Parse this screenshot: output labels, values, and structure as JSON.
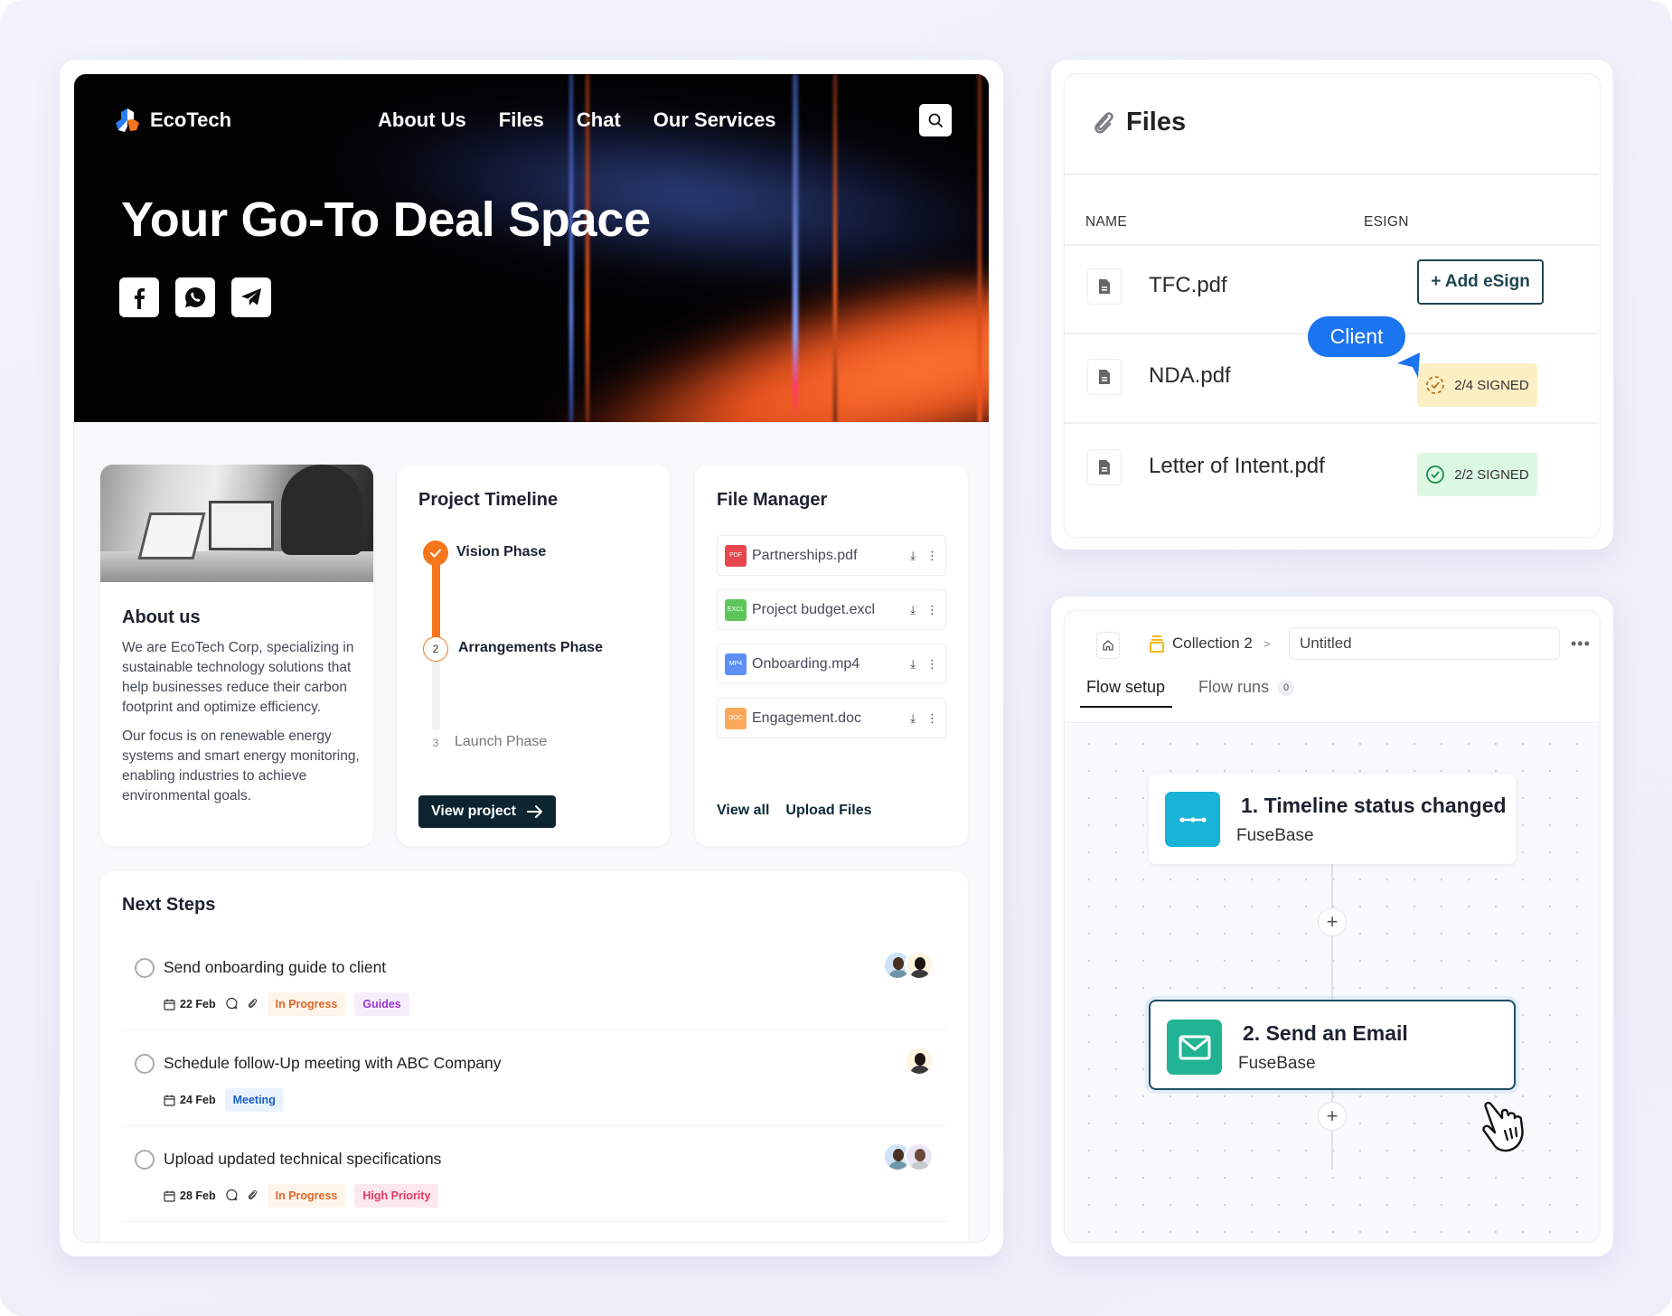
{
  "brand": {
    "name": "EcoTech",
    "logo_icon": "ecotech-logo-icon"
  },
  "nav": {
    "items": [
      "About Us",
      "Files",
      "Chat",
      "Our Services"
    ],
    "search_icon": "search-icon"
  },
  "hero": {
    "title": "Your Go-To Deal Space",
    "social": [
      "facebook-icon",
      "whatsapp-icon",
      "telegram-icon"
    ]
  },
  "about": {
    "title": "About us",
    "paragraphs": [
      "We are EcoTech Corp, specializing in sustainable technology solutions that help businesses reduce their carbon footprint and optimize efficiency.",
      "Our focus is on renewable energy systems and smart energy monitoring, enabling industries to achieve environmental goals."
    ]
  },
  "timeline": {
    "title": "Project Timeline",
    "progress_fraction": 0.5,
    "phases": [
      {
        "step": "✓",
        "label": "Vision Phase",
        "status": "done"
      },
      {
        "step": "2",
        "label": "Arrangements Phase",
        "status": "current"
      },
      {
        "step": "3",
        "label": "Launch Phase",
        "status": "upcoming"
      }
    ],
    "button": "View project"
  },
  "file_manager": {
    "title": "File Manager",
    "files": [
      {
        "type": "PDF",
        "name": "Partnerships.pdf",
        "color": "#e5474d"
      },
      {
        "type": "EXCL",
        "name": "Project budget.excl",
        "color": "#5cc65a"
      },
      {
        "type": "MP4",
        "name": "Onboarding.mp4",
        "color": "#5b8ff5"
      },
      {
        "type": "DOC",
        "name": "Engagement.doc",
        "color": "#f8a858"
      }
    ],
    "actions": {
      "download": "⤓",
      "more": "⋮"
    },
    "links": [
      "View all",
      "Upload Files"
    ]
  },
  "next_steps": {
    "title": "Next Steps",
    "items": [
      {
        "text": "Send onboarding guide to client",
        "date": "22 Feb",
        "has_comments": true,
        "has_attachments": true,
        "tags": [
          {
            "label": "In Progress",
            "fg": "#e0672a",
            "bg": "#fff4ea"
          },
          {
            "label": "Guides",
            "fg": "#9b36d6",
            "bg": "#f7eefd"
          }
        ],
        "avatars": 2
      },
      {
        "text": "Schedule follow-Up meeting with ABC Company",
        "date": "24 Feb",
        "has_comments": false,
        "has_attachments": false,
        "tags": [
          {
            "label": "Meeting",
            "fg": "#1b5fc9",
            "bg": "#eaf3fd"
          }
        ],
        "avatars": 1
      },
      {
        "text": "Upload updated technical specifications",
        "date": "28 Feb",
        "has_comments": true,
        "has_attachments": true,
        "tags": [
          {
            "label": "In Progress",
            "fg": "#e0672a",
            "bg": "#fff4ea"
          },
          {
            "label": "High Priority",
            "fg": "#e23a5f",
            "bg": "#fde8ee"
          }
        ],
        "avatars": 2
      }
    ]
  },
  "files_panel": {
    "title": "Files",
    "columns": {
      "name": "NAME",
      "esign": "ESIGN"
    },
    "rows": [
      {
        "name": "TFC.pdf",
        "esign": {
          "kind": "button",
          "label": "+ Add eSign"
        }
      },
      {
        "name": "NDA.pdf",
        "esign": {
          "kind": "status",
          "label": "2/4 SIGNED",
          "bg": "#fdefc4",
          "icon_color": "#b8761a"
        }
      },
      {
        "name": "Letter of Intent.pdf",
        "esign": {
          "kind": "status",
          "label": "2/2 SIGNED",
          "bg": "#dcf8e3",
          "icon_color": "#1f8a49"
        }
      }
    ],
    "cursor_label": "Client"
  },
  "flow": {
    "breadcrumb": {
      "collection": "Collection 2",
      "separator": ">",
      "title_value": "Untitled"
    },
    "more_label": "•••",
    "tabs": [
      {
        "label": "Flow setup",
        "active": true
      },
      {
        "label": "Flow runs",
        "count": "0",
        "active": false
      }
    ],
    "steps": [
      {
        "title": "1. Timeline status changed",
        "subtitle": "FuseBase",
        "icon": "timeline-icon",
        "color": "#18b3d6"
      },
      {
        "title": "2. Send an Email",
        "subtitle": "FuseBase",
        "icon": "mail-icon",
        "color": "#20b494"
      }
    ],
    "add_label": "+"
  }
}
